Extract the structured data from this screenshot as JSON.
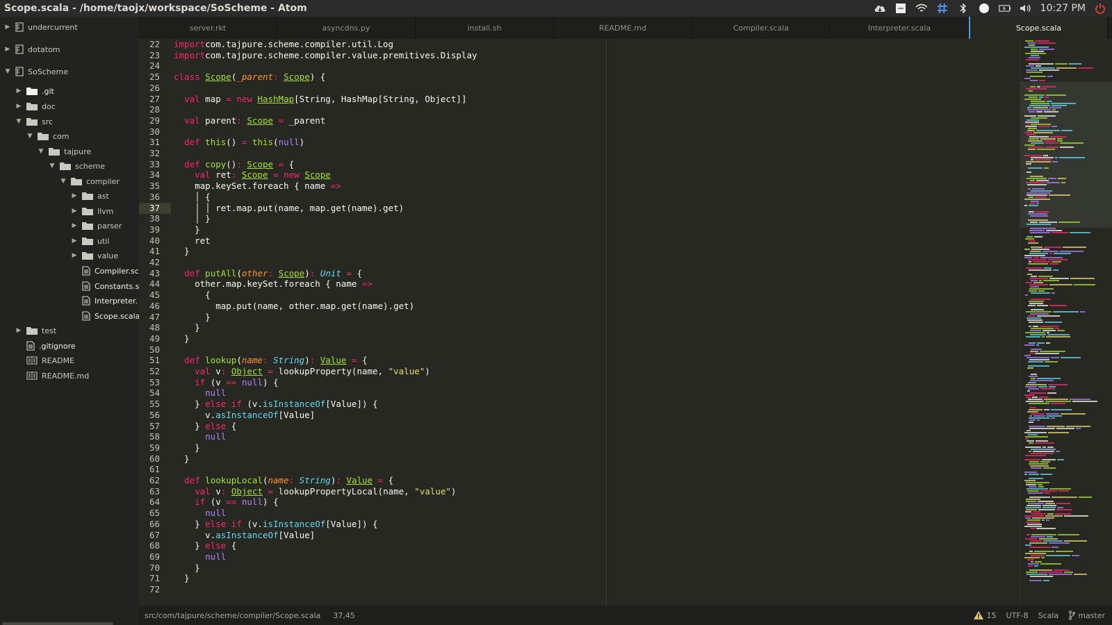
{
  "window": {
    "title": "Scope.scala - /home/taojx/workspace/SoScheme - Atom"
  },
  "tray": {
    "icons": [
      "cloud-icon",
      "keyboard-indicator-icon",
      "wifi-icon",
      "grid-icon",
      "bluetooth-icon",
      "chat-icon",
      "battery-icon",
      "volume-icon",
      "power-icon"
    ],
    "time": "10:27 PM"
  },
  "sidebar": {
    "items": [
      {
        "label": "undercurrent",
        "type": "repo",
        "expanded": false
      },
      {
        "label": "dotatom",
        "type": "repo",
        "expanded": false
      },
      {
        "label": "SoScheme",
        "type": "repo",
        "expanded": true
      },
      {
        "label": ".git",
        "type": "folder-bright",
        "expanded": false
      },
      {
        "label": "doc",
        "type": "folder",
        "expanded": false
      },
      {
        "label": "src",
        "type": "folder",
        "expanded": true
      },
      {
        "label": "com",
        "type": "folder",
        "expanded": true
      },
      {
        "label": "tajpure",
        "type": "folder",
        "expanded": true
      },
      {
        "label": "scheme",
        "type": "folder",
        "expanded": true
      },
      {
        "label": "compiler",
        "type": "folder",
        "expanded": true
      },
      {
        "label": "ast",
        "type": "folder",
        "expanded": false
      },
      {
        "label": "llvm",
        "type": "folder",
        "expanded": false
      },
      {
        "label": "parser",
        "type": "folder",
        "expanded": false
      },
      {
        "label": "util",
        "type": "folder",
        "expanded": false
      },
      {
        "label": "value",
        "type": "folder",
        "expanded": false
      },
      {
        "label": "Compiler.sc",
        "type": "file",
        "expanded": null
      },
      {
        "label": "Constants.s",
        "type": "file",
        "expanded": null
      },
      {
        "label": "Interpreter.",
        "type": "file",
        "expanded": null
      },
      {
        "label": "Scope.scala",
        "type": "file",
        "expanded": null
      },
      {
        "label": "test",
        "type": "folder",
        "expanded": false
      },
      {
        "label": ".gitignore",
        "type": "file",
        "expanded": null
      },
      {
        "label": "README",
        "type": "book",
        "expanded": null
      },
      {
        "label": "README.md",
        "type": "book",
        "expanded": null
      }
    ]
  },
  "tabs": [
    {
      "label": "server.rkt",
      "active": false
    },
    {
      "label": "asyncdns.py",
      "active": false
    },
    {
      "label": "install.sh",
      "active": false
    },
    {
      "label": "README.md",
      "active": false
    },
    {
      "label": "Compiler.scala",
      "active": false
    },
    {
      "label": "Interpreter.scala",
      "active": false
    },
    {
      "label": "Scope.scala",
      "active": true
    }
  ],
  "editor": {
    "current_line": 37,
    "lines": [
      {
        "n": "22",
        "tokens": [
          [
            "k",
            "import"
          ],
          [
            "",
            "com.tajpure.scheme.compiler.util.Log"
          ]
        ]
      },
      {
        "n": "23",
        "tokens": [
          [
            "k",
            "import"
          ],
          [
            "",
            "com.tajpure.scheme.compiler.value.premitives.Display"
          ]
        ]
      },
      {
        "n": "24",
        "tokens": []
      },
      {
        "n": "25",
        "tokens": [
          [
            "k",
            "class"
          ],
          [
            "",
            ""
          ],
          [
            "t",
            "Scope"
          ],
          [
            "",
            "("
          ],
          [
            "p",
            "_parent"
          ],
          [
            "k",
            ":"
          ],
          [
            "",
            ""
          ],
          [
            "t",
            "Scope"
          ],
          [
            "",
            ") {"
          ]
        ]
      },
      {
        "n": "26",
        "tokens": []
      },
      {
        "n": "27",
        "tokens": [
          [
            "",
            "  "
          ],
          [
            "k",
            "val"
          ],
          [
            "",
            " map "
          ],
          [
            "k",
            "="
          ],
          [
            "",
            ""
          ],
          [
            "k",
            "new"
          ],
          [
            "",
            ""
          ],
          [
            "t",
            "HashMap"
          ],
          [
            "",
            "[String, HashMap[String, Object]]"
          ]
        ]
      },
      {
        "n": "28",
        "tokens": []
      },
      {
        "n": "29",
        "tokens": [
          [
            "",
            "  "
          ],
          [
            "k",
            "val"
          ],
          [
            "",
            " parent"
          ],
          [
            "k",
            ":"
          ],
          [
            "",
            ""
          ],
          [
            "t",
            "Scope"
          ],
          [
            "",
            ""
          ],
          [
            "k",
            "="
          ],
          [
            "",
            " _parent"
          ]
        ]
      },
      {
        "n": "30",
        "tokens": []
      },
      {
        "n": "31",
        "tokens": [
          [
            "",
            "  "
          ],
          [
            "k",
            "def"
          ],
          [
            "",
            ""
          ],
          [
            "f",
            "this"
          ],
          [
            "",
            "() "
          ],
          [
            "k",
            "="
          ],
          [
            "",
            ""
          ],
          [
            "f",
            "this"
          ],
          [
            "",
            "("
          ],
          [
            "n",
            "null"
          ],
          [
            "",
            ")"
          ]
        ]
      },
      {
        "n": "32",
        "tokens": []
      },
      {
        "n": "33",
        "tokens": [
          [
            "",
            "  "
          ],
          [
            "k",
            "def"
          ],
          [
            "",
            ""
          ],
          [
            "f",
            "copy"
          ],
          [
            "",
            "()"
          ],
          [
            "k",
            ":"
          ],
          [
            "",
            ""
          ],
          [
            "t",
            "Scope"
          ],
          [
            "",
            ""
          ],
          [
            "k",
            "="
          ],
          [
            "",
            " {"
          ]
        ]
      },
      {
        "n": "34",
        "tokens": [
          [
            "",
            "    "
          ],
          [
            "k",
            "val"
          ],
          [
            "",
            " ret"
          ],
          [
            "k",
            ":"
          ],
          [
            "",
            ""
          ],
          [
            "t",
            "Scope"
          ],
          [
            "",
            ""
          ],
          [
            "k",
            "="
          ],
          [
            "",
            ""
          ],
          [
            "k",
            "new"
          ],
          [
            "",
            ""
          ],
          [
            "t",
            "Scope"
          ]
        ]
      },
      {
        "n": "35",
        "tokens": [
          [
            "",
            "    map.keySet.foreach { name "
          ],
          [
            "k",
            "=>"
          ]
        ]
      },
      {
        "n": "36",
        "tokens": [
          [
            "",
            "    │ {"
          ]
        ]
      },
      {
        "n": "37",
        "tokens": [
          [
            "",
            "    │ │ ret.map.put(name, map.get(name).get)"
          ]
        ]
      },
      {
        "n": "38",
        "tokens": [
          [
            "",
            "    │ }"
          ]
        ]
      },
      {
        "n": "39",
        "tokens": [
          [
            "",
            "    }"
          ]
        ]
      },
      {
        "n": "40",
        "tokens": [
          [
            "",
            "    ret"
          ]
        ]
      },
      {
        "n": "41",
        "tokens": [
          [
            "",
            "  }"
          ]
        ]
      },
      {
        "n": "42",
        "tokens": []
      },
      {
        "n": "43",
        "tokens": [
          [
            "",
            "  "
          ],
          [
            "k",
            "def"
          ],
          [
            "",
            ""
          ],
          [
            "f",
            "putAll"
          ],
          [
            "",
            "("
          ],
          [
            "p",
            "other"
          ],
          [
            "k",
            ":"
          ],
          [
            "",
            ""
          ],
          [
            "t",
            "Scope"
          ],
          [
            "",
            ")"
          ],
          [
            "k",
            ":"
          ],
          [
            "",
            ""
          ],
          [
            "it",
            "Unit"
          ],
          [
            "",
            ""
          ],
          [
            "k",
            "="
          ],
          [
            "",
            " {"
          ]
        ]
      },
      {
        "n": "44",
        "tokens": [
          [
            "",
            "    other.map.keySet.foreach { name "
          ],
          [
            "k",
            "=>"
          ]
        ]
      },
      {
        "n": "45",
        "tokens": [
          [
            "",
            "      {"
          ]
        ]
      },
      {
        "n": "46",
        "tokens": [
          [
            "",
            "        map.put(name, other.map.get(name).get)"
          ]
        ]
      },
      {
        "n": "47",
        "tokens": [
          [
            "",
            "      }"
          ]
        ]
      },
      {
        "n": "48",
        "tokens": [
          [
            "",
            "    }"
          ]
        ]
      },
      {
        "n": "49",
        "tokens": [
          [
            "",
            "  }"
          ]
        ]
      },
      {
        "n": "50",
        "tokens": []
      },
      {
        "n": "51",
        "tokens": [
          [
            "",
            "  "
          ],
          [
            "k",
            "def"
          ],
          [
            "",
            ""
          ],
          [
            "f",
            "lookup"
          ],
          [
            "",
            "("
          ],
          [
            "p",
            "name"
          ],
          [
            "k",
            ":"
          ],
          [
            "",
            ""
          ],
          [
            "it",
            "String"
          ],
          [
            "",
            ")"
          ],
          [
            "k",
            ":"
          ],
          [
            "",
            ""
          ],
          [
            "t",
            "Value"
          ],
          [
            "",
            ""
          ],
          [
            "k",
            "="
          ],
          [
            "",
            " {"
          ]
        ]
      },
      {
        "n": "52",
        "tokens": [
          [
            "",
            "    "
          ],
          [
            "k",
            "val"
          ],
          [
            "",
            " v"
          ],
          [
            "k",
            ":"
          ],
          [
            "",
            ""
          ],
          [
            "t",
            "Object"
          ],
          [
            "",
            ""
          ],
          [
            "k",
            "="
          ],
          [
            "",
            " lookupProperty(name, "
          ],
          [
            "s",
            "\"value\""
          ],
          [
            "",
            ")"
          ]
        ]
      },
      {
        "n": "53",
        "tokens": [
          [
            "",
            "    "
          ],
          [
            "k",
            "if"
          ],
          [
            "",
            " (v "
          ],
          [
            "k",
            "=="
          ],
          [
            "",
            ""
          ],
          [
            "n",
            "null"
          ],
          [
            "",
            ") {"
          ]
        ]
      },
      {
        "n": "54",
        "tokens": [
          [
            "",
            "      "
          ],
          [
            "n",
            "null"
          ]
        ]
      },
      {
        "n": "55",
        "tokens": [
          [
            "",
            "    } "
          ],
          [
            "k",
            "else"
          ],
          [
            "",
            ""
          ],
          [
            "k",
            "if"
          ],
          [
            "",
            " (v."
          ],
          [
            "m",
            "isInstanceOf"
          ],
          [
            "",
            "[Value]) {"
          ]
        ]
      },
      {
        "n": "56",
        "tokens": [
          [
            "",
            "      v."
          ],
          [
            "m",
            "asInstanceOf"
          ],
          [
            "",
            "[Value]"
          ]
        ]
      },
      {
        "n": "57",
        "tokens": [
          [
            "",
            "    } "
          ],
          [
            "k",
            "else"
          ],
          [
            "",
            " {"
          ]
        ]
      },
      {
        "n": "58",
        "tokens": [
          [
            "",
            "      "
          ],
          [
            "n",
            "null"
          ]
        ]
      },
      {
        "n": "59",
        "tokens": [
          [
            "",
            "    }"
          ]
        ]
      },
      {
        "n": "60",
        "tokens": [
          [
            "",
            "  }"
          ]
        ]
      },
      {
        "n": "61",
        "tokens": []
      },
      {
        "n": "62",
        "tokens": [
          [
            "",
            "  "
          ],
          [
            "k",
            "def"
          ],
          [
            "",
            ""
          ],
          [
            "f",
            "lookupLocal"
          ],
          [
            "",
            "("
          ],
          [
            "p",
            "name"
          ],
          [
            "k",
            ":"
          ],
          [
            "",
            ""
          ],
          [
            "it",
            "String"
          ],
          [
            "",
            ")"
          ],
          [
            "k",
            ":"
          ],
          [
            "",
            ""
          ],
          [
            "t",
            "Value"
          ],
          [
            "",
            ""
          ],
          [
            "k",
            "="
          ],
          [
            "",
            " {"
          ]
        ]
      },
      {
        "n": "63",
        "tokens": [
          [
            "",
            "    "
          ],
          [
            "k",
            "val"
          ],
          [
            "",
            " v"
          ],
          [
            "k",
            ":"
          ],
          [
            "",
            ""
          ],
          [
            "t",
            "Object"
          ],
          [
            "",
            ""
          ],
          [
            "k",
            "="
          ],
          [
            "",
            " lookupPropertyLocal(name, "
          ],
          [
            "s",
            "\"value\""
          ],
          [
            "",
            ")"
          ]
        ]
      },
      {
        "n": "64",
        "tokens": [
          [
            "",
            "    "
          ],
          [
            "k",
            "if"
          ],
          [
            "",
            " (v "
          ],
          [
            "k",
            "=="
          ],
          [
            "",
            ""
          ],
          [
            "n",
            "null"
          ],
          [
            "",
            ") {"
          ]
        ]
      },
      {
        "n": "65",
        "tokens": [
          [
            "",
            "      "
          ],
          [
            "n",
            "null"
          ]
        ]
      },
      {
        "n": "66",
        "tokens": [
          [
            "",
            "    } "
          ],
          [
            "k",
            "else"
          ],
          [
            "",
            ""
          ],
          [
            "k",
            "if"
          ],
          [
            "",
            " (v."
          ],
          [
            "m",
            "isInstanceOf"
          ],
          [
            "",
            "[Value]) {"
          ]
        ]
      },
      {
        "n": "67",
        "tokens": [
          [
            "",
            "      v."
          ],
          [
            "m",
            "asInstanceOf"
          ],
          [
            "",
            "[Value]"
          ]
        ]
      },
      {
        "n": "68",
        "tokens": [
          [
            "",
            "    } "
          ],
          [
            "k",
            "else"
          ],
          [
            "",
            " {"
          ]
        ]
      },
      {
        "n": "69",
        "tokens": [
          [
            "",
            "      "
          ],
          [
            "n",
            "null"
          ]
        ]
      },
      {
        "n": "70",
        "tokens": [
          [
            "",
            "    }"
          ]
        ]
      },
      {
        "n": "71",
        "tokens": [
          [
            "",
            "  }"
          ]
        ]
      },
      {
        "n": "72",
        "tokens": []
      }
    ]
  },
  "status": {
    "path": "src/com/tajpure/scheme/compiler/Scope.scala",
    "cursor": "37,45",
    "warnings": "15",
    "encoding": "UTF-8",
    "grammar": "Scala",
    "branch": "master"
  },
  "colors": {
    "keyword": "#f92672",
    "type": "#a6e22e",
    "number": "#ae81ff",
    "string": "#e6db74",
    "param": "#fd971f",
    "builtin": "#66d9ef",
    "accent": "#5a9de0"
  }
}
